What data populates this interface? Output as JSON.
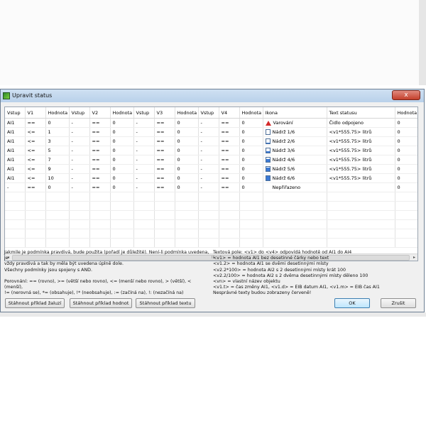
{
  "window": {
    "title": "Upravit status",
    "close_glyph": "x"
  },
  "table": {
    "columns": [
      "Vstup",
      "V1",
      "Hodnota",
      "Vstup",
      "V2",
      "Hodnota",
      "Vstup",
      "V3",
      "Hodnota",
      "Vstup",
      "V4",
      "Hodnota",
      "Ikona",
      "Text statusu",
      "Hodnota"
    ],
    "rows": [
      [
        "AI1",
        "==",
        "0",
        "-",
        "==",
        "0",
        "-",
        "==",
        "0",
        "-",
        "==",
        "0",
        {
          "icon": "warning-icon",
          "color": "#d42a2a",
          "label": "Varování"
        },
        "Čidlo odpojeno",
        "0"
      ],
      [
        "AI1",
        "<=",
        "1",
        "-",
        "==",
        "0",
        "-",
        "==",
        "0",
        "-",
        "==",
        "0",
        {
          "icon": "tank-icon",
          "level": 0.0,
          "label": "Nádrž 1/6"
        },
        "<v1*555.75> litrů",
        "0"
      ],
      [
        "AI1",
        "<=",
        "3",
        "-",
        "==",
        "0",
        "-",
        "==",
        "0",
        "-",
        "==",
        "0",
        {
          "icon": "tank-icon",
          "level": 0.2,
          "label": "Nádrž 2/6"
        },
        "<v1*555.75> litrů",
        "0"
      ],
      [
        "AI1",
        "<=",
        "5",
        "-",
        "==",
        "0",
        "-",
        "==",
        "0",
        "-",
        "==",
        "0",
        {
          "icon": "tank-icon",
          "level": 0.4,
          "label": "Nádrž 3/6"
        },
        "<v1*555.75> litrů",
        "0"
      ],
      [
        "AI1",
        "<=",
        "7",
        "-",
        "==",
        "0",
        "-",
        "==",
        "0",
        "-",
        "==",
        "0",
        {
          "icon": "tank-icon",
          "level": 0.6,
          "label": "Nádrž 4/6"
        },
        "<v1*555.75> litrů",
        "0"
      ],
      [
        "AI1",
        "<=",
        "9",
        "-",
        "==",
        "0",
        "-",
        "==",
        "0",
        "-",
        "==",
        "0",
        {
          "icon": "tank-icon",
          "level": 0.8,
          "label": "Nádrž 5/6"
        },
        "<v1*555.75> litrů",
        "0"
      ],
      [
        "AI1",
        "<=",
        "10",
        "-",
        "==",
        "0",
        "-",
        "==",
        "0",
        "-",
        "==",
        "0",
        {
          "icon": "tank-icon",
          "level": 1.0,
          "label": "Nádrž 6/6"
        },
        "<v1*555.75> litrů",
        "0"
      ],
      [
        "-",
        "==",
        "0",
        "-",
        "==",
        "0",
        "-",
        "==",
        "0",
        "-",
        "==",
        "0",
        {
          "icon": "none",
          "label": "Nepřiřazeno"
        },
        "",
        "0"
      ]
    ],
    "scroll_grip": "III"
  },
  "help_left": [
    "Jakmile je podmínka pravdivá, bude použita (pořadí je důležité). Není-li podmínka uvedena, je",
    "vždy pravdivá a tak by měla být uvedena úplně dole.",
    "Všechny podmínky jsou spojeny s AND.",
    "",
    "Porovnání: == (rovno), >= (větší nebo rovno), <= (menší nebo rovno), > (větší), < (menší),",
    "!= (nerovná se), *= (obsahuje), !* (neobsahuje), := (začíná na), !: (nezačíná na)"
  ],
  "help_right": [
    "Textová pole: <v1> do <v4> odpovídá hodnotě od AI1 do AI4",
    "<v1> = hodnota AI1 bez desetinné čárky nebo text",
    "<v1.2> = hodnota AI1 se dvěmi desetinnými místy",
    "<v2.2*100> = hodnota AI2 s 2 desetinnými místy krát 100",
    "<v2.2/100> = hodnota AI2 s 2 dvěma desetinnými místy děleno 100",
    "<vn> = vlastní název objektu",
    "<v1.t> = čas změny AI1, <v1.d> = EIB datum AI1, <v1.m> = EIB čas AI1",
    "Nesprávné texty budou zobrazeny červeně!"
  ],
  "buttons": {
    "blinds": "Stáhnout příklad žaluzí",
    "values": "Stáhnout příklad hodnot",
    "text": "Stáhnout příklad textu",
    "ok": "OK",
    "cancel": "Zrušit"
  }
}
